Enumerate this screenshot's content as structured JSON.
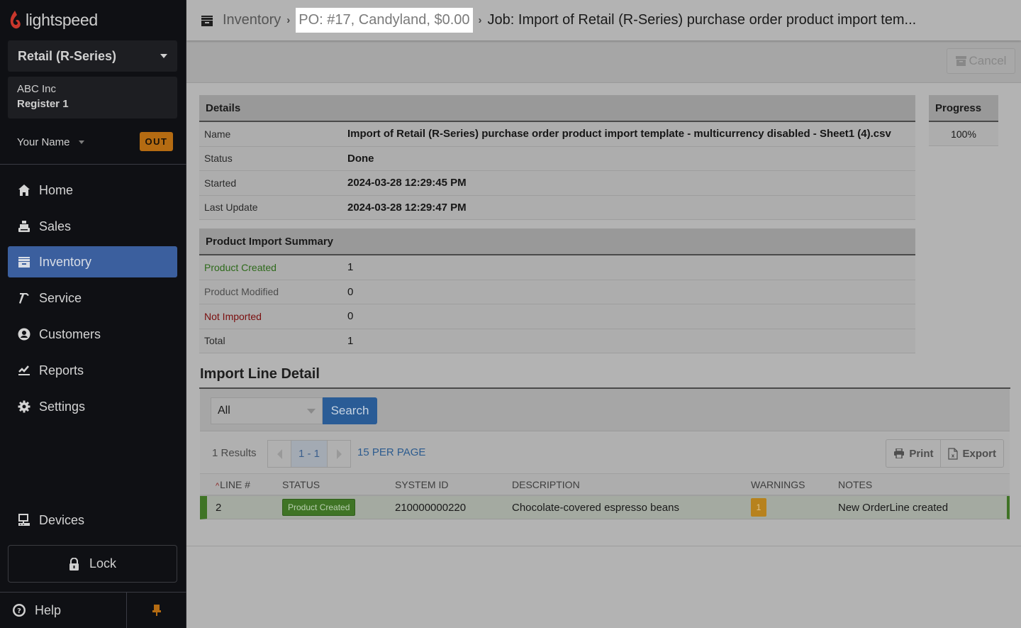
{
  "app": {
    "brand": "lightspeed",
    "accent_color": "#3b5f9e",
    "brand_color": "#d9453b"
  },
  "sidebar": {
    "shop_select": "Retail (R-Series)",
    "company": "ABC Inc",
    "register": "Register 1",
    "user_name": "Your Name",
    "out_badge": "OUT",
    "nav": [
      {
        "label": "Home",
        "icon": "home-icon",
        "active": false
      },
      {
        "label": "Sales",
        "icon": "cash-register-icon",
        "active": false
      },
      {
        "label": "Inventory",
        "icon": "archive-box-icon",
        "active": true
      },
      {
        "label": "Service",
        "icon": "hammer-icon",
        "active": false
      },
      {
        "label": "Customers",
        "icon": "user-circle-icon",
        "active": false
      },
      {
        "label": "Reports",
        "icon": "chart-line-icon",
        "active": false
      },
      {
        "label": "Settings",
        "icon": "gear-icon",
        "active": false
      }
    ],
    "devices": "Devices",
    "lock": "Lock",
    "help": "Help"
  },
  "breadcrumb": {
    "items": [
      "Inventory",
      "PO: #17, Candyland, $0.00"
    ],
    "current": "Job:  Import of Retail (R-Series) purchase order product import tem..."
  },
  "toolbar": {
    "cancel_label": "Cancel"
  },
  "details": {
    "title": "Details",
    "rows": [
      {
        "label": "Name",
        "value": "Import of Retail (R-Series) purchase order product import template - multicurrency disabled - Sheet1 (4).csv"
      },
      {
        "label": "Status",
        "value": "Done"
      },
      {
        "label": "Started",
        "value": "2024-03-28 12:29:45 PM"
      },
      {
        "label": "Last Update",
        "value": "2024-03-28 12:29:47 PM"
      }
    ]
  },
  "progress": {
    "title": "Progress",
    "value": "100%"
  },
  "summary": {
    "title": "Product Import Summary",
    "rows": [
      {
        "label": "Product Created",
        "value": "1",
        "tone": "green"
      },
      {
        "label": "Product Modified",
        "value": "0",
        "tone": "gray"
      },
      {
        "label": "Not Imported",
        "value": "0",
        "tone": "red"
      },
      {
        "label": "Total",
        "value": "1",
        "tone": "default"
      }
    ]
  },
  "import_lines": {
    "title": "Import Line Detail",
    "filter_value": "All",
    "search_label": "Search",
    "results_count": "1 Results",
    "page_range": "1 - 1",
    "per_page": "15 PER PAGE",
    "print_label": "Print",
    "export_label": "Export",
    "columns": [
      "LINE #",
      "STATUS",
      "SYSTEM ID",
      "DESCRIPTION",
      "WARNINGS",
      "NOTES"
    ],
    "rows": [
      {
        "line": "2",
        "status": "Product Created",
        "system_id": "210000000220",
        "description": "Chocolate-covered espresso beans",
        "warnings": "1",
        "notes": "New OrderLine created"
      }
    ]
  }
}
